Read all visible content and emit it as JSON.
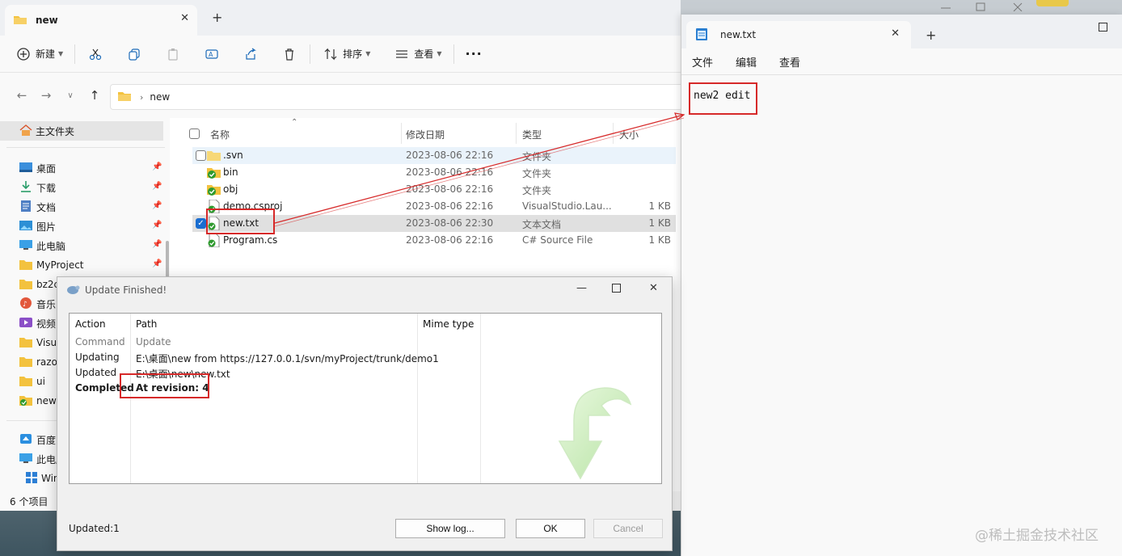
{
  "explorer": {
    "tab_title": "new",
    "toolbar": {
      "new_label": "新建",
      "sort_label": "排序",
      "view_label": "查看",
      "more_label": "···"
    },
    "breadcrumb": [
      "new"
    ],
    "sidebar": {
      "home_label": "主文件夹",
      "items": [
        {
          "label": "桌面",
          "icon": "desktop-icon",
          "pinned": true
        },
        {
          "label": "下载",
          "icon": "download-icon",
          "pinned": true
        },
        {
          "label": "文档",
          "icon": "document-icon",
          "pinned": true
        },
        {
          "label": "图片",
          "icon": "picture-icon",
          "pinned": true
        },
        {
          "label": "此电脑",
          "icon": "computer-icon",
          "pinned": true
        },
        {
          "label": "MyProject",
          "icon": "folder-icon",
          "pinned": true
        },
        {
          "label": "bz2c",
          "icon": "folder-icon",
          "pinned": false
        },
        {
          "label": "音乐",
          "icon": "music-icon",
          "pinned": false
        },
        {
          "label": "视频",
          "icon": "video-icon",
          "pinned": false
        },
        {
          "label": "Visua",
          "icon": "folder-icon",
          "pinned": false
        },
        {
          "label": "razo",
          "icon": "folder-icon",
          "pinned": false
        },
        {
          "label": "ui",
          "icon": "folder-icon",
          "pinned": false
        },
        {
          "label": "new",
          "icon": "svn-folder-icon",
          "pinned": false
        }
      ],
      "bottom_items": [
        {
          "label": "百度网",
          "icon": "cloud-icon"
        },
        {
          "label": "此电脑",
          "icon": "computer-icon"
        },
        {
          "label": "Win",
          "icon": "windows-icon"
        }
      ]
    },
    "columns": {
      "name": "名称",
      "date": "修改日期",
      "type": "类型",
      "size": "大小"
    },
    "files": [
      {
        "name": ".svn",
        "date": "2023-08-06 22:16",
        "type": "文件夹",
        "size": "",
        "kind": "folder"
      },
      {
        "name": "bin",
        "date": "2023-08-06 22:16",
        "type": "文件夹",
        "size": "",
        "kind": "svn-folder"
      },
      {
        "name": "obj",
        "date": "2023-08-06 22:16",
        "type": "文件夹",
        "size": "",
        "kind": "svn-folder"
      },
      {
        "name": "demo.csproj",
        "date": "2023-08-06 22:16",
        "type": "VisualStudio.Lau...",
        "size": "1 KB",
        "kind": "svn-file"
      },
      {
        "name": "new.txt",
        "date": "2023-08-06 22:30",
        "type": "文本文档",
        "size": "1 KB",
        "kind": "svn-file",
        "selected": true
      },
      {
        "name": "Program.cs",
        "date": "2023-08-06 22:16",
        "type": "C# Source File",
        "size": "1 KB",
        "kind": "svn-file"
      }
    ],
    "status": "6 个项目"
  },
  "notepad": {
    "tab_title": "new.txt",
    "menu": [
      "文件",
      "编辑",
      "查看"
    ],
    "content": "new2 edit"
  },
  "svn_dialog": {
    "title": "Update Finished!",
    "columns": {
      "action": "Action",
      "path": "Path",
      "mime": "Mime type"
    },
    "rows": [
      {
        "action": "Command",
        "path": "Update",
        "style": "muted"
      },
      {
        "action": "Updating",
        "path": "E:\\桌面\\new from https://127.0.0.1/svn/myProject/trunk/demo1",
        "style": "normal"
      },
      {
        "action": "Updated",
        "path": "E:\\桌面\\new\\new.txt",
        "style": "normal"
      },
      {
        "action": "Completed",
        "path": "At revision: 4",
        "style": "bold"
      }
    ],
    "status": "Updated:1",
    "buttons": {
      "show_log": "Show log...",
      "ok": "OK",
      "cancel": "Cancel"
    }
  },
  "watermark": "@稀土掘金技术社区",
  "colors": {
    "annotation_red": "#d62929",
    "selection_blue": "#1a6dd0",
    "svn_green": "#2e9a2e",
    "folder_yellow": "#f3c23e"
  }
}
